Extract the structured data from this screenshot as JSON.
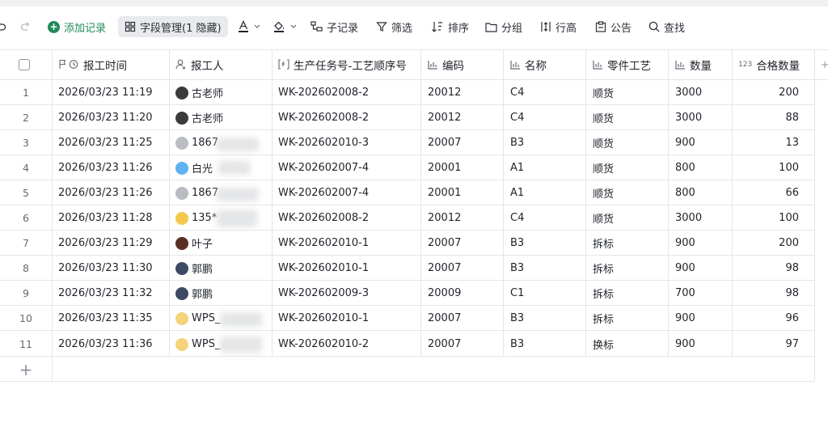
{
  "toolbar": {
    "add_record": "添加记录",
    "field_manage": "字段管理(1 隐藏)",
    "sub_record": "子记录",
    "filter": "筛选",
    "sort": "排序",
    "group": "分组",
    "row_height": "行高",
    "notice": "公告",
    "find": "查找"
  },
  "columns": [
    {
      "key": "time",
      "label": "报工时间",
      "icon": "flag-clock-icon"
    },
    {
      "key": "reporter",
      "label": "报工人",
      "icon": "person-icon"
    },
    {
      "key": "task",
      "label": "生产任务号-工艺顺序号",
      "icon": "formula-icon"
    },
    {
      "key": "code",
      "label": "编码",
      "icon": "bar-chart-icon"
    },
    {
      "key": "name",
      "label": "名称",
      "icon": "bar-chart-icon"
    },
    {
      "key": "process",
      "label": "零件工艺",
      "icon": "bar-chart-icon"
    },
    {
      "key": "qty",
      "label": "数量",
      "icon": "bar-chart-icon"
    },
    {
      "key": "passed",
      "label": "合格数量",
      "icon": "number-icon",
      "icon_text": "123"
    }
  ],
  "rows": [
    {
      "n": "1",
      "time": "2026/03/23 11:19",
      "reporter": "古老师",
      "avatar": "#3b3b3b",
      "task": "WK-202602008-2",
      "code": "20012",
      "name": "C4",
      "process": "顺货",
      "qty": "3000",
      "passed": "200"
    },
    {
      "n": "2",
      "time": "2026/03/23 11:20",
      "reporter": "古老师",
      "avatar": "#3b3b3b",
      "task": "WK-202602008-2",
      "code": "20012",
      "name": "C4",
      "process": "顺货",
      "qty": "3000",
      "passed": "88"
    },
    {
      "n": "3",
      "time": "2026/03/23 11:25",
      "reporter": "1867",
      "avatar": "#b9bcc2",
      "task": "WK-202602010-3",
      "code": "20007",
      "name": "B3",
      "process": "顺货",
      "qty": "900",
      "passed": "13"
    },
    {
      "n": "4",
      "time": "2026/03/23 11:26",
      "reporter": "白光",
      "avatar": "#5fb2f0",
      "task": "WK-202602007-4",
      "code": "20001",
      "name": "A1",
      "process": "顺货",
      "qty": "800",
      "passed": "100"
    },
    {
      "n": "5",
      "time": "2026/03/23 11:26",
      "reporter": "1867",
      "avatar": "#b9bcc2",
      "task": "WK-202602007-4",
      "code": "20001",
      "name": "A1",
      "process": "顺货",
      "qty": "800",
      "passed": "66"
    },
    {
      "n": "6",
      "time": "2026/03/23 11:28",
      "reporter": "135*",
      "avatar": "#f2c94c",
      "task": "WK-202602008-2",
      "code": "20012",
      "name": "C4",
      "process": "顺货",
      "qty": "3000",
      "passed": "100"
    },
    {
      "n": "7",
      "time": "2026/03/23 11:29",
      "reporter": "叶子",
      "avatar": "#5a2d22",
      "task": "WK-202602010-1",
      "code": "20007",
      "name": "B3",
      "process": "拆标",
      "qty": "900",
      "passed": "200"
    },
    {
      "n": "8",
      "time": "2026/03/23 11:30",
      "reporter": "郭鹏",
      "avatar": "#3d4a63",
      "task": "WK-202602010-1",
      "code": "20007",
      "name": "B3",
      "process": "拆标",
      "qty": "900",
      "passed": "98"
    },
    {
      "n": "9",
      "time": "2026/03/23 11:32",
      "reporter": "郭鹏",
      "avatar": "#3d4a63",
      "task": "WK-202602009-3",
      "code": "20009",
      "name": "C1",
      "process": "拆标",
      "qty": "700",
      "passed": "98"
    },
    {
      "n": "10",
      "time": "2026/03/23 11:35",
      "reporter": "WPS_",
      "avatar": "#f4d37a",
      "task": "WK-202602010-1",
      "code": "20007",
      "name": "B3",
      "process": "拆标",
      "qty": "900",
      "passed": "96"
    },
    {
      "n": "11",
      "time": "2026/03/23 11:36",
      "reporter": "WPS_",
      "avatar": "#f4d37a",
      "task": "WK-202602010-2",
      "code": "20007",
      "name": "B3",
      "process": "换标",
      "qty": "900",
      "passed": "97"
    }
  ],
  "add_row_symbol": "+"
}
